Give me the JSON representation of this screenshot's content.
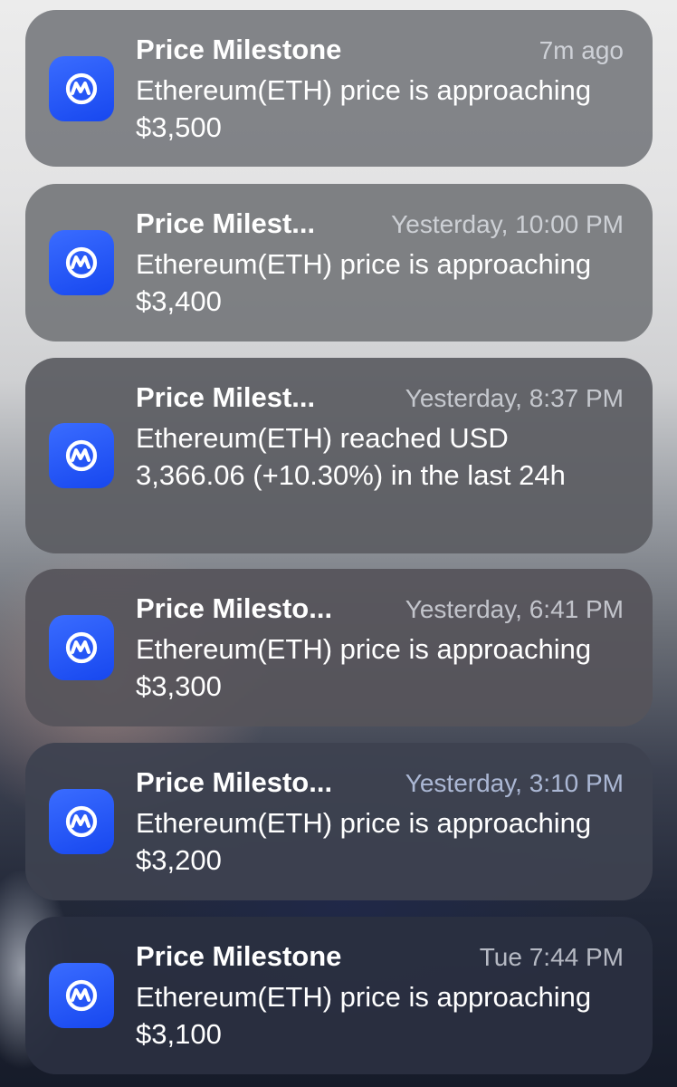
{
  "notifications": [
    {
      "title": "Price Milestone",
      "time": "7m ago",
      "body": "Ethereum(ETH) price is approaching $3,500"
    },
    {
      "title": "Price Milest...",
      "time": "Yesterday, 10:00 PM",
      "body": "Ethereum(ETH) price is approaching $3,400"
    },
    {
      "title": "Price Milest...",
      "time": "Yesterday, 8:37 PM",
      "body": "Ethereum(ETH) reached USD 3,366.06 (+10.30%) in the last 24h"
    },
    {
      "title": "Price Milesto...",
      "time": "Yesterday, 6:41 PM",
      "body": "Ethereum(ETH) price is approaching $3,300"
    },
    {
      "title": "Price Milesto...",
      "time": "Yesterday, 3:10 PM",
      "body": "Ethereum(ETH) price is approaching $3,200"
    },
    {
      "title": "Price Milestone",
      "time": "Tue 7:44 PM",
      "body": "Ethereum(ETH) price is approaching $3,100"
    }
  ],
  "app_icon": {
    "name": "coinmarketcap-icon",
    "color": "#1f55f5"
  }
}
